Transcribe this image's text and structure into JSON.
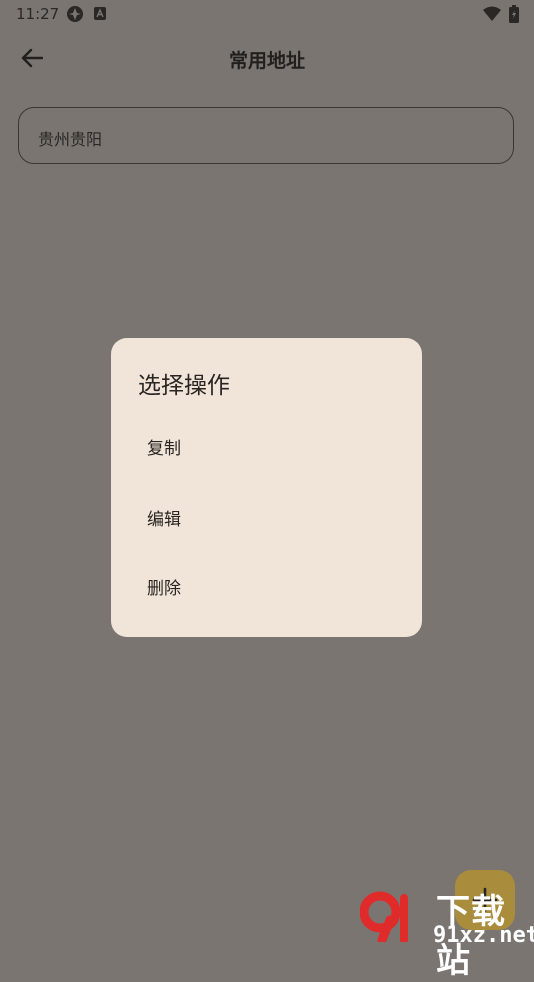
{
  "status_bar": {
    "time": "11:27"
  },
  "app_bar": {
    "title": "常用地址"
  },
  "address": {
    "value": "贵州贵阳"
  },
  "dialog": {
    "title": "选择操作",
    "items": [
      {
        "label": "复制"
      },
      {
        "label": "编辑"
      },
      {
        "label": "删除"
      }
    ]
  },
  "watermark": {
    "text_cn": "下载站",
    "url": "91xz.net"
  },
  "colors": {
    "scrim_background": "#7a7571",
    "dialog_background": "#f1e5d9",
    "fab_background": "#a98c3c",
    "watermark_red": "#e02b2b"
  }
}
